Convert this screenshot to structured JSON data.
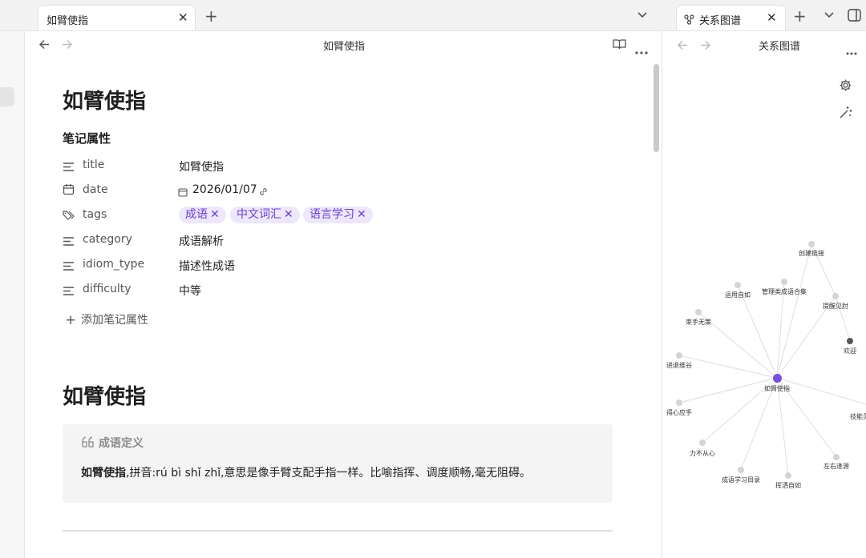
{
  "tabs": {
    "left": {
      "label": "如臂使指"
    },
    "right": {
      "label": "关系图谱"
    }
  },
  "main": {
    "nav_title": "如臂使指",
    "title": "如臂使指",
    "properties_heading": "笔记属性",
    "properties": [
      {
        "name": "title",
        "value": "如臂使指",
        "icon": "text-lines-icon"
      },
      {
        "name": "date",
        "value": "2026/01/07",
        "icon": "calendar-icon"
      },
      {
        "name": "tags",
        "value": "",
        "icon": "tags-icon"
      },
      {
        "name": "category",
        "value": "成语解析",
        "icon": "text-lines-icon"
      },
      {
        "name": "idiom_type",
        "value": "描述性成语",
        "icon": "text-lines-icon"
      },
      {
        "name": "difficulty",
        "value": "中等",
        "icon": "text-lines-icon"
      }
    ],
    "tags": [
      "成语",
      "中文词汇",
      "语言学习"
    ],
    "add_property_label": "添加笔记属性",
    "section_heading": "如臂使指",
    "callout": {
      "title": "成语定义",
      "body_bold": "如臂使指",
      "body_rest": ",拼音:rú bì shǐ zhǐ,意思是像手臂支配手指一样。比喻指挥、调度顺畅,毫无阻碍。"
    }
  },
  "graph": {
    "nav_title": "关系图谱",
    "center": "如臂使指",
    "nodes": [
      "创建链接",
      "运用自如",
      "管理类成语合集",
      "提醒见肘",
      "束手无策",
      "欢迎",
      "进退维谷",
      "得心应手",
      "技能灵",
      "力不从心",
      "左右逢源",
      "成语学习目录",
      "挥洒自如"
    ],
    "colors": {
      "center": "#7c4ddb",
      "node": "#d4d4d4",
      "highlight": "#555555",
      "edge": "#dddddd"
    }
  },
  "colors": {
    "accent": "#6d3fd0",
    "tag_bg": "#ede7fb"
  }
}
